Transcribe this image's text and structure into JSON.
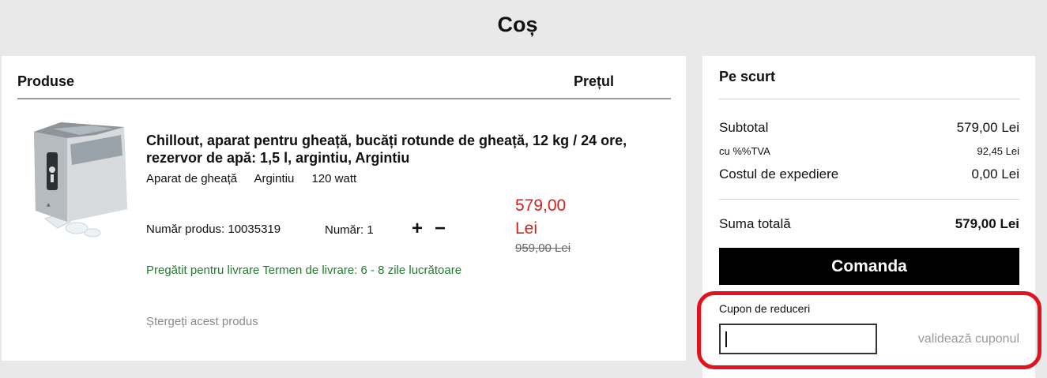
{
  "page": {
    "title": "Coș"
  },
  "cart": {
    "header": {
      "products": "Produse",
      "price": "Prețul"
    },
    "item": {
      "title": "Chillout, aparat pentru gheață, bucăți rotunde de gheață, 12 kg / 24 ore, rezervor de apă: 1,5 l, argintiu, Argintiu",
      "attributes": [
        "Aparat de gheață",
        "Argintiu",
        "120 watt"
      ],
      "product_number": "Număr produs: 10035319",
      "quantity": "Număr: 1",
      "plus": "+",
      "minus": "−",
      "price": "579,00 Lei",
      "old_price": "959,00 Lei",
      "delivery": "Pregătit pentru livrare Termen de livrare: 6 - 8 zile lucrătoare",
      "remove": "Ștergeți acest produs"
    }
  },
  "summary": {
    "title": "Pe scurt",
    "subtotal_label": "Subtotal",
    "subtotal_value": "579,00 Lei",
    "vat_label": "cu %%TVA",
    "vat_value": "92,45 Lei",
    "shipping_label": "Costul de expediere",
    "shipping_value": "0,00 Lei",
    "total_label": "Suma totală",
    "total_value": "579,00 Lei",
    "order_button": "Comanda",
    "coupon_label": "Cupon de reduceri",
    "coupon_value": "",
    "coupon_validate": "validează cuponul"
  },
  "colors": {
    "price_red": "#d2221e",
    "delivery_green": "#227a2e",
    "highlight_red": "#e0141e",
    "button_black": "#000000"
  }
}
